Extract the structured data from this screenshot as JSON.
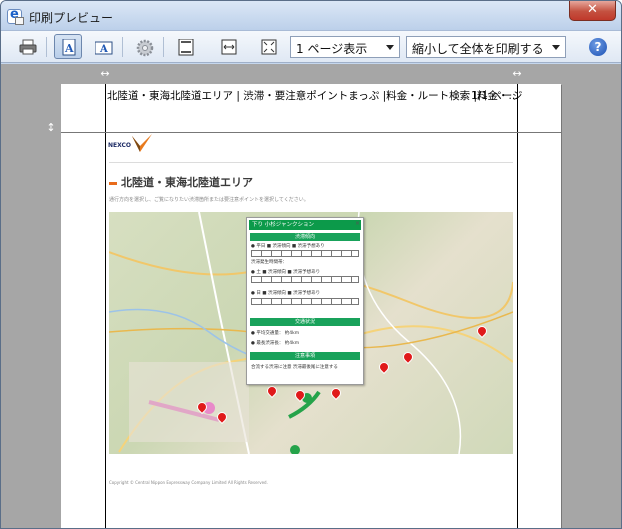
{
  "window": {
    "title": "印刷プレビュー",
    "close_label": "✕"
  },
  "toolbar": {
    "page_view_select": "1 ページ表示",
    "shrink_select": "縮小して全体を印刷する",
    "help_label": "?"
  },
  "page": {
    "header_text": "北陸道・東海北陸道エリア | 渋滞・要注意ポイントまっぷ |料金・ルート検索 |料金・...",
    "page_number": "1/1 ページ",
    "logo_text": "NEXCO",
    "section_title": "北陸道・東海北陸道エリア",
    "subnote": "通行方向を選択し、ご覧になりたい渋滞箇所または要注意ポイントを選択してください。",
    "copyright": "Copyright © Central Nippon Expressway Company Limited All Rights Reserved."
  },
  "popup": {
    "head": "下り 小杉ジャンクション",
    "bands": [
      "渋滞傾向",
      "交通状況",
      "注意事項"
    ],
    "lines": [
      "● 平日 ■ 渋滞傾向 ■ 渋滞予想あり",
      "渋滞発生時間帯：",
      "● 土 ■ 渋滞傾向 ■ 渋滞予想あり",
      "● 日 ■ 渋滞傾向 ■ 渋滞予想あり",
      "● 平均交通量：  約4km",
      "● 最長渋滞長：  約4km",
      "合流する渋滞に注意 渋滞最後尾に注意する"
    ],
    "close": "×"
  },
  "colors": {
    "accent": "#e86b1b",
    "popup_green": "#0c9a4a",
    "pin_red": "#e01a1a"
  }
}
